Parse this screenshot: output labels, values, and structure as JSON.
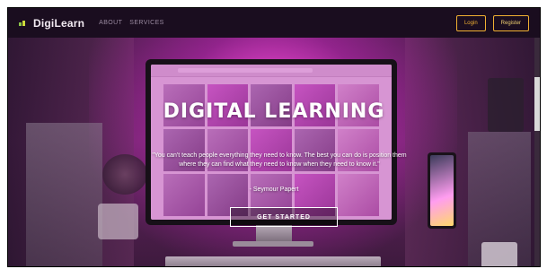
{
  "navbar": {
    "brand": "DigiLearn",
    "links": [
      {
        "label": "ABOUT"
      },
      {
        "label": "SERVICES"
      }
    ],
    "login_label": "Login",
    "register_label": "Register"
  },
  "hero": {
    "title": "DIGITAL LEARNING",
    "quote": "\"You can't teach people everything they need to know. The best you can do is position them where they can find what they need to know when they need to know it.\"",
    "author": "- Seymour Papert",
    "cta_label": "GET STARTED"
  },
  "colors": {
    "navbar_bg": "#1a0d1f",
    "accent": "#f0b032",
    "hero_glow": "#ff4fe0"
  }
}
